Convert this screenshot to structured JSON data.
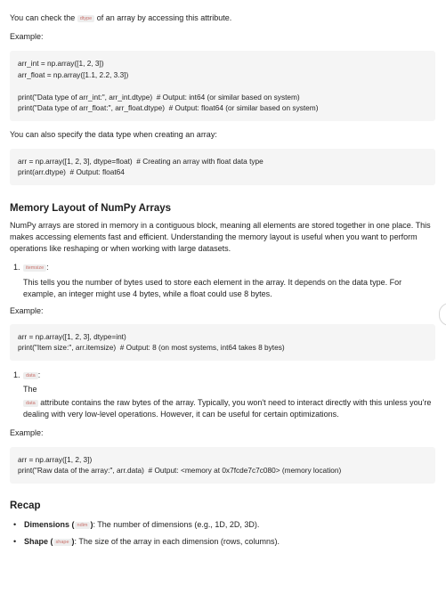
{
  "intro": {
    "pre": "You can check the ",
    "code": "dtype",
    "post": " of an array by accessing this attribute."
  },
  "example_label": "Example:",
  "code1": "arr_int = np.array([1, 2, 3])\narr_float = np.array([1.1, 2.2, 3.3])\n\nprint(\"Data type of arr_int:\", arr_int.dtype)  # Output: int64 (or similar based on system)\nprint(\"Data type of arr_float:\", arr_float.dtype)  # Output: float64 (or similar based on system)",
  "specify_text": "You can also specify the data type when creating an array:",
  "code2": "arr = np.array([1, 2, 3], dtype=float)  # Creating an array with float data type\nprint(arr.dtype)  # Output: float64",
  "memory_heading": "Memory Layout of NumPy Arrays",
  "memory_para": "NumPy arrays are stored in memory in a contiguous block, meaning all elements are stored together in one place. This makes accessing elements fast and efficient. Understanding the memory layout is useful when you want to perform operations like reshaping or when working with large datasets.",
  "item1": {
    "num": "1.",
    "code": "itemsize",
    "colon": ":",
    "desc": "This tells you the number of bytes used to store each element in the array. It depends on the data type. For example, an integer might use 4 bytes, while a float could use 8 bytes."
  },
  "code3": "arr = np.array([1, 2, 3], dtype=int)\nprint(\"Item size:\", arr.itemsize)  # Output: 8 (on most systems, int64 takes 8 bytes)",
  "item2": {
    "num": "1.",
    "code": "data",
    "colon": ":",
    "the": "The",
    "code_inline": "data",
    "desc": " attribute contains the raw bytes of the array. Typically, you won't need to interact directly with this unless you're dealing with very low-level operations. However, it can be useful for certain optimizations."
  },
  "code4": "arr = np.array([1, 2, 3])\nprint(\"Raw data of the array:\", arr.data)  # Output: <memory at 0x7fcde7c7c080> (memory location)",
  "recap_heading": "Recap",
  "recap": [
    {
      "bold": "Dimensions",
      "open": " (",
      "code": "ndim",
      "close": ")",
      "rest": ": The number of dimensions (e.g., 1D, 2D, 3D)."
    },
    {
      "bold": "Shape",
      "open": " (",
      "code": "shape",
      "close": ")",
      "rest": ": The size of the array in each dimension (rows, columns)."
    }
  ],
  "bullet": "•"
}
